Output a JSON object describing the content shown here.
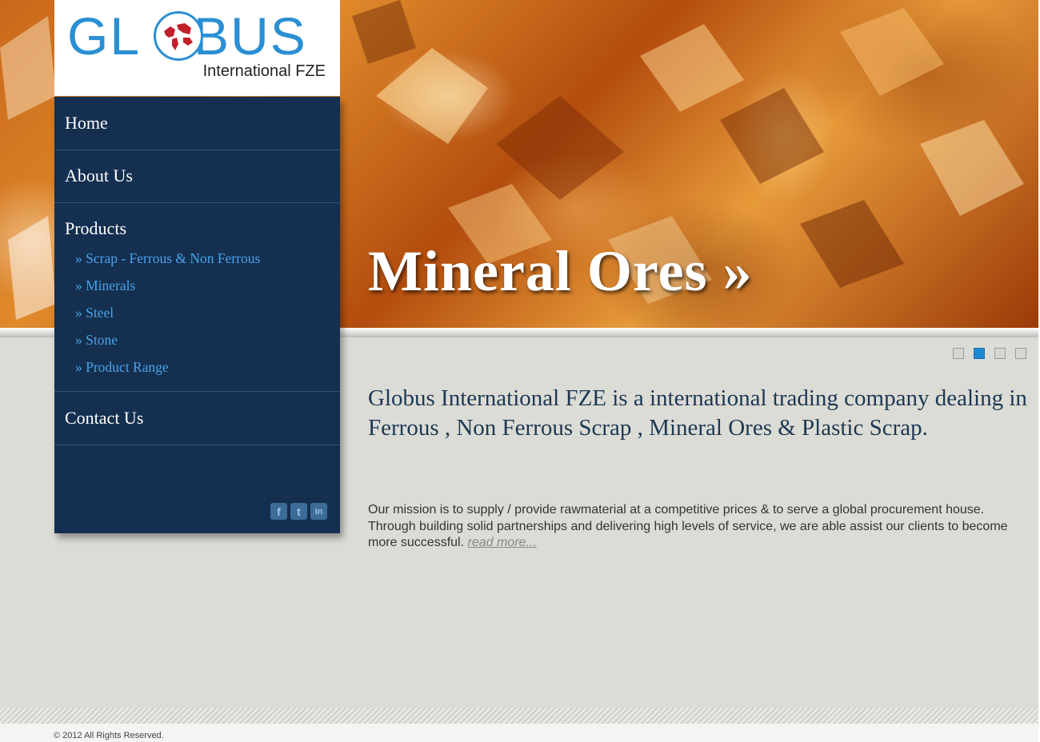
{
  "logo": {
    "word": "GLOBUS",
    "subtitle": "International FZE"
  },
  "hero": {
    "title": "Mineral Ores »"
  },
  "slider": {
    "dots": 4,
    "active_index": 1
  },
  "nav": {
    "items": [
      {
        "label": "Home"
      },
      {
        "label": "About Us"
      },
      {
        "label": "Products"
      },
      {
        "label": "Contact Us"
      }
    ],
    "products_sub": [
      {
        "label": "» Scrap - Ferrous & Non Ferrous"
      },
      {
        "label": "» Minerals"
      },
      {
        "label": "» Steel"
      },
      {
        "label": "» Stone"
      },
      {
        "label": "» Product Range"
      }
    ],
    "social": [
      {
        "icon": "facebook-icon",
        "glyph": "f"
      },
      {
        "icon": "twitter-icon",
        "glyph": "t"
      },
      {
        "icon": "linkedin-icon",
        "glyph": "in"
      }
    ]
  },
  "content": {
    "headline": "Globus International FZE is a international trading company dealing in Ferrous , Non Ferrous Scrap , Mineral Ores & Plastic Scrap.",
    "mission": "Our mission is to supply / provide rawmaterial at a competitive prices & to serve a global procurement house. Through building solid partnerships and delivering high levels of service, we are able assist our clients to become more successful.",
    "read_more": "read more..."
  },
  "footer": {
    "copyright": "© 2012 All Rights Reserved."
  },
  "colors": {
    "nav_bg": "#142f50",
    "link": "#4aa3e8",
    "brand": "#2a8fd3",
    "active_dot": "#1e8ad6"
  }
}
